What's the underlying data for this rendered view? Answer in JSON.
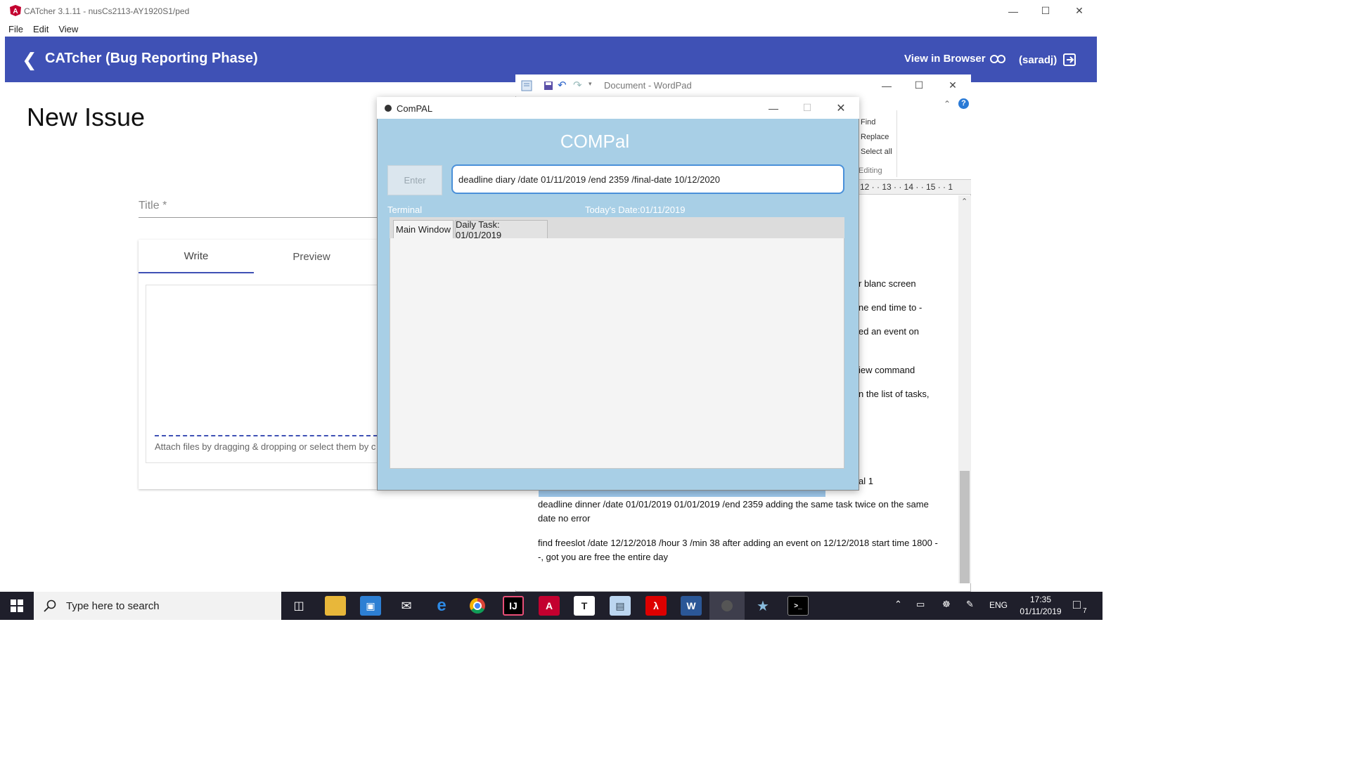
{
  "catcher": {
    "window_title": "CATcher 3.1.11 - nusCs2113-AY1920S1/ped",
    "menu": [
      "File",
      "Edit",
      "View"
    ],
    "header_title": "CATcher  (Bug Reporting Phase)",
    "view_in_browser": "View in Browser",
    "user": "(saradj)",
    "page_title": "New Issue",
    "title_placeholder": "Title *",
    "tab_write": "Write",
    "tab_preview": "Preview",
    "attach_hint": "Attach files by dragging & dropping or select them by c",
    "accent": "#3f51b5"
  },
  "wordpad": {
    "window_title": "Document - WordPad",
    "editing": {
      "find": "Find",
      "replace": "Replace",
      "select_all": "Select all",
      "group": "Editing"
    },
    "ruler": "12 · · 13 · · 14 · · 15 · · 1",
    "fragments": [
      "r blanc screen",
      "ne end time to -",
      "ed an event on",
      "iew command",
      "n the list of tasks,",
      "al 1"
    ],
    "paragraphs": [
      "deadline dinner /date 01/01/2019 01/01/2019 /end 2359 adding the same task twice on the same date no error",
      "find freeslot /date 12/12/2018 /hour 3 /min 38 after adding an event on 12/12/2018 start time 1800 - -, got you are free the entire day"
    ]
  },
  "compal": {
    "window_title": "ComPAL",
    "heading": "COMPal",
    "enter_label": "Enter",
    "command_value": "deadline diary /date 01/11/2019 /end 2359 /final-date 10/12/2020",
    "terminal_label": "Terminal",
    "today_label": "Today's Date:01/11/2019",
    "tabs": [
      "Main Window",
      "Daily Task: 01/01/2019"
    ],
    "bg_color": "#a8cfe6"
  },
  "taskbar": {
    "search_placeholder": "Type here to search",
    "language": "ENG",
    "time": "17:35",
    "date": "01/11/2019",
    "notifications": "7",
    "apps": [
      "task-view-icon",
      "file-explorer-icon",
      "store-icon",
      "mail-icon",
      "edge-icon",
      "chrome-icon",
      "intellij-icon",
      "angular-icon",
      "typora-icon",
      "wordpad-icon",
      "acrobat-icon",
      "word-icon",
      "compal-icon",
      "paint-icon",
      "terminal-icon"
    ]
  }
}
